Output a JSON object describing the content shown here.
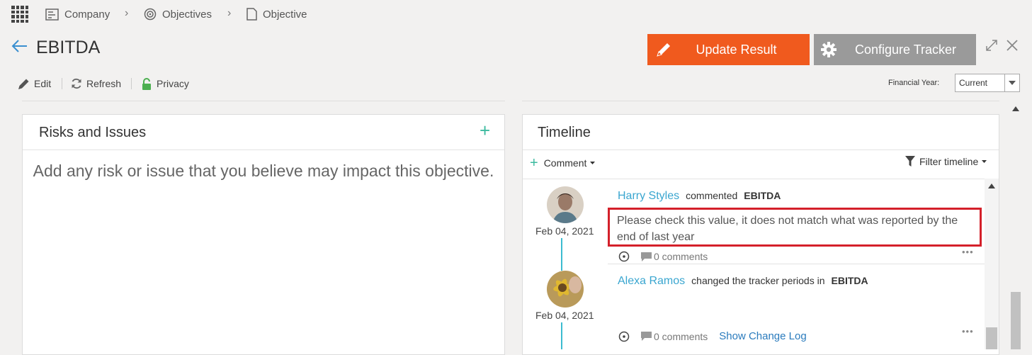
{
  "breadcrumb": {
    "items": [
      {
        "label": "Company"
      },
      {
        "label": "Objectives"
      },
      {
        "label": "Objective"
      }
    ]
  },
  "header": {
    "title": "EBITDA",
    "update_label": "Update Result",
    "configure_label": "Configure Tracker"
  },
  "toolbar": {
    "edit_label": "Edit",
    "refresh_label": "Refresh",
    "privacy_label": "Privacy",
    "financial_year_label": "Financial Year:",
    "financial_year_value": "Current"
  },
  "risks": {
    "title": "Risks and Issues",
    "empty_text": "Add any risk or issue that you believe may impact this objective."
  },
  "timeline": {
    "title": "Timeline",
    "comment_label": "Comment",
    "filter_label": "Filter timeline",
    "entries": [
      {
        "author": "Harry Styles",
        "action": "commented",
        "object": "EBITDA",
        "date": "Feb 04, 2021",
        "text": "Please check this value, it does not match what was reported by the end of last year",
        "comments": "0 comments"
      },
      {
        "author": "Alexa Ramos",
        "action": "changed the tracker periods in",
        "object": "EBITDA",
        "date": "Feb 04, 2021",
        "comments": "0 comments",
        "link": "Show Change Log"
      }
    ]
  },
  "colors": {
    "accent_orange": "#f05a1e",
    "configure_gray": "#9a9a9a",
    "teal": "#3cba9f",
    "link_blue": "#3aa6d0",
    "highlight_red": "#d4202a"
  }
}
